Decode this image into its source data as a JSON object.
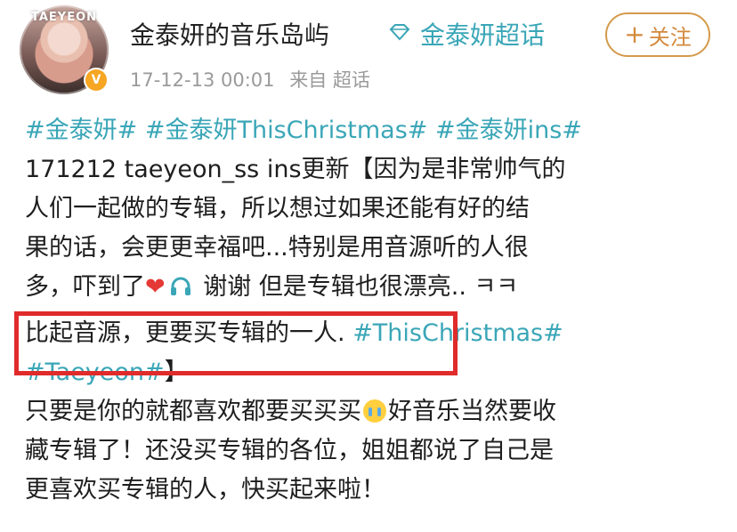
{
  "post": {
    "username": "金泰妍的音乐岛屿",
    "supertopic": "金泰妍超话",
    "follow_label": "关注",
    "date": "17-12-13 00:01",
    "source": "来自 超话",
    "avatar_text": "TAEYEON",
    "verified_badge": "V"
  },
  "content": {
    "line1_tags": [
      "#金泰妍#",
      "#金泰妍ThisChristmas#",
      "#金泰妍ins#"
    ],
    "line2": "171212 taeyeon_ss ins更新【因为是非常帅气的",
    "line3": "人们一起做的专辑，所以想过如果还能有好的结",
    "line4": "果的话，会更更幸福吧...特别是用音源听的人很",
    "line5a": "多，吓到了",
    "line5b": "谢谢 但是专辑也很漂亮.. ㅋㅋ",
    "line6a": "比起音源，更要买专辑的一人.",
    "line6_tag": "#ThisChristmas#",
    "line7_tag": "#Taeyeon#",
    "line7_end": "】",
    "line8a": "只要是你的就都喜欢都要买买买",
    "line8b": "好音乐当然要收",
    "line9": "藏专辑了！还没买专辑的各位，姐姐都说了自己是",
    "line10": "更喜欢买专辑的人，快买起来啦！"
  },
  "colors": {
    "accent": "#3aa6b7",
    "follow": "#d4893c",
    "highlight": "#e02b2b",
    "meta": "#9a9a9a"
  },
  "icons": [
    "diamond-icon",
    "heart-icon",
    "headphones-icon",
    "crying-face-icon",
    "plus-icon"
  ]
}
